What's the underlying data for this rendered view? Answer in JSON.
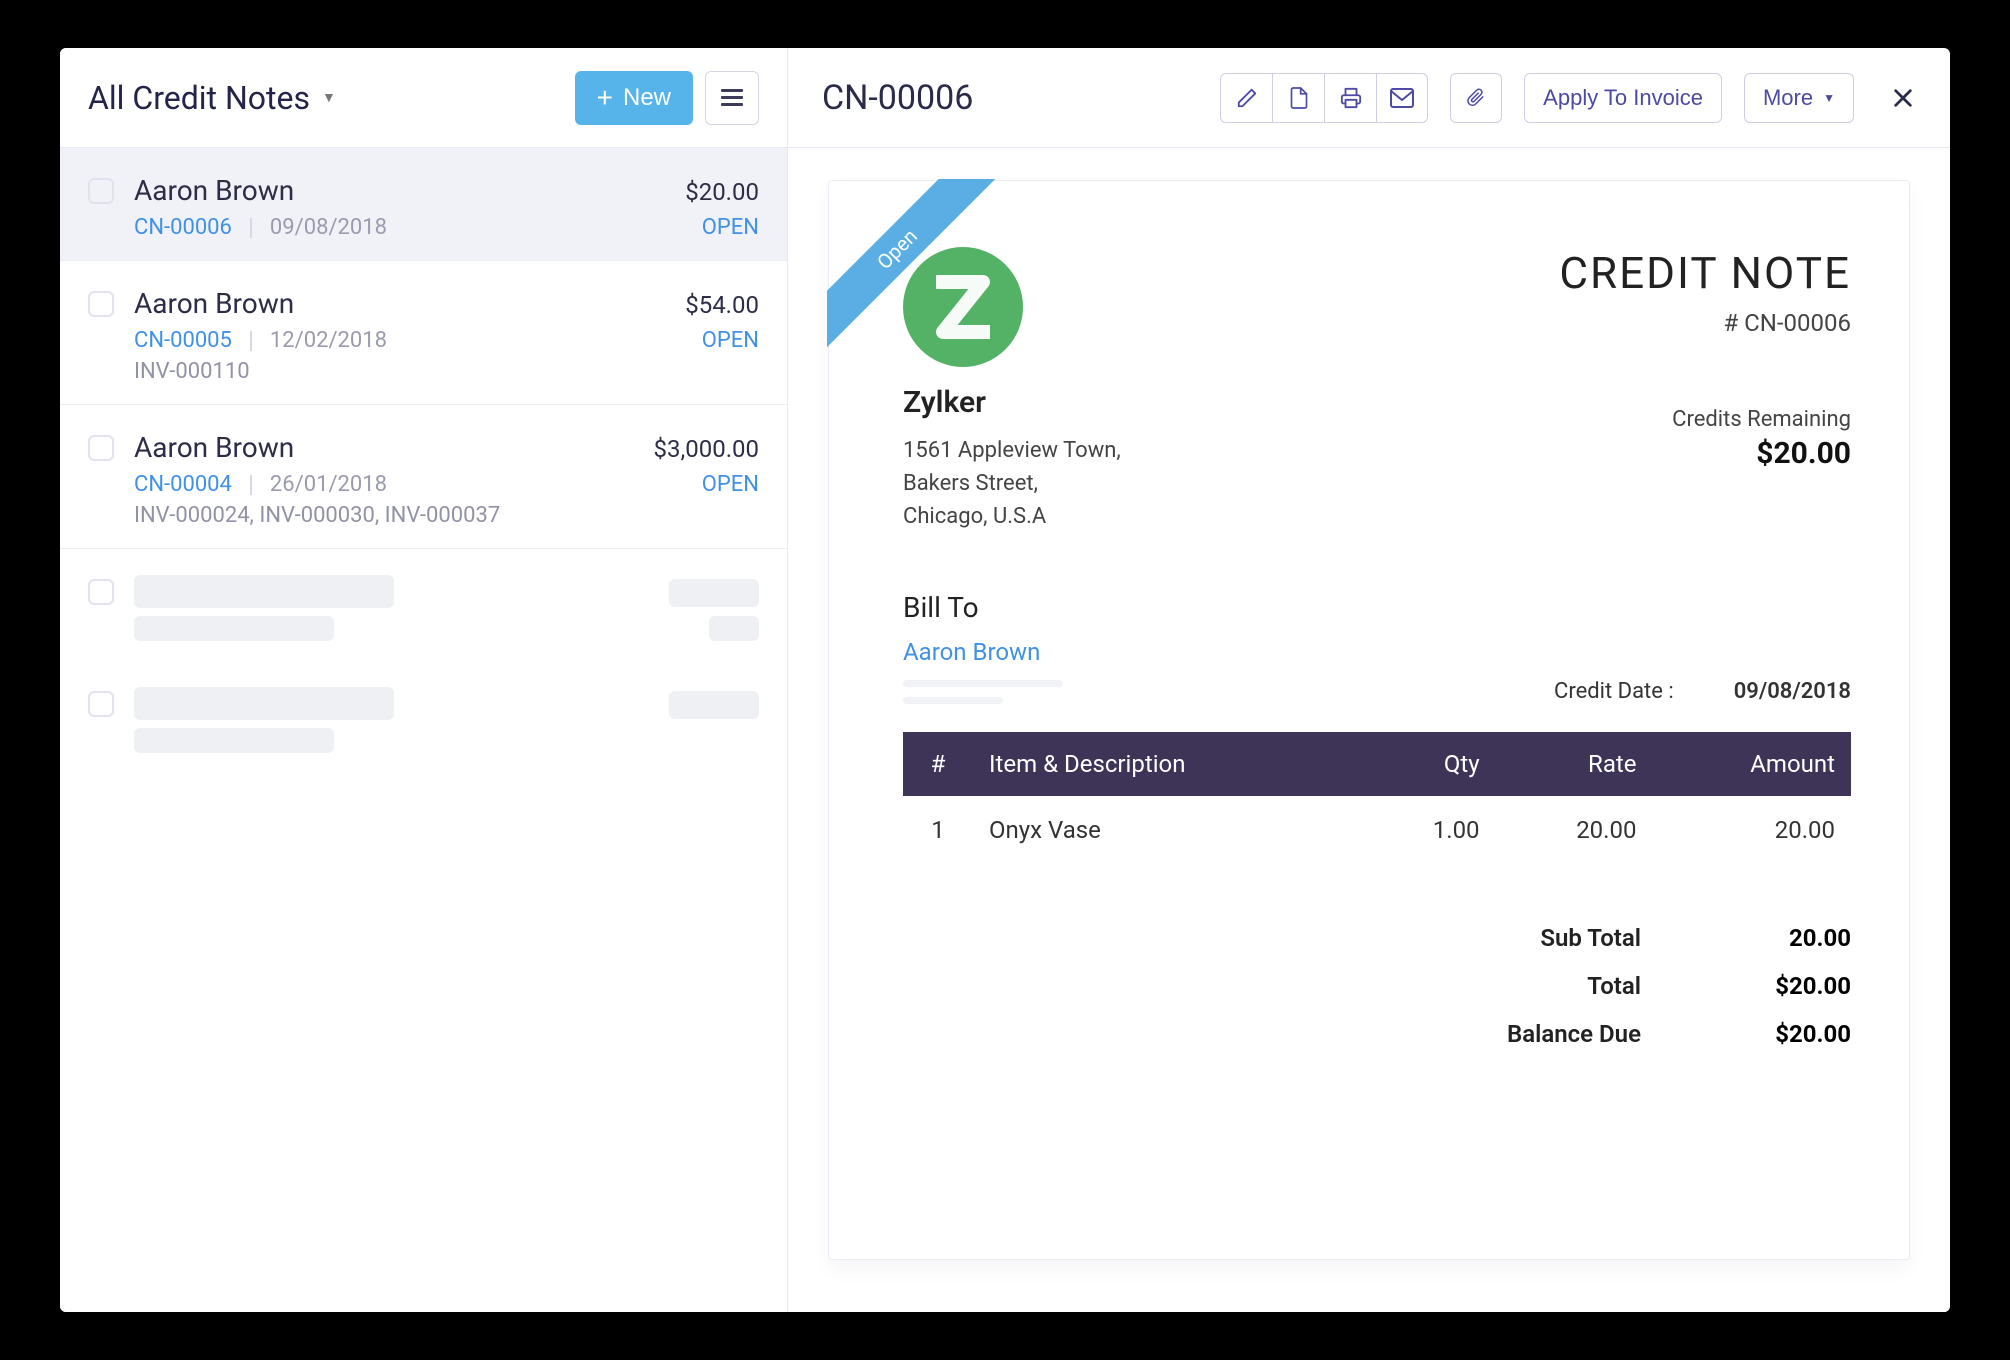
{
  "sidebar": {
    "title": "All Credit Notes",
    "new_label": "New",
    "items": [
      {
        "name": "Aaron Brown",
        "amount": "$20.00",
        "id": "CN-00006",
        "date": "09/08/2018",
        "status": "OPEN",
        "invoices": "",
        "selected": true
      },
      {
        "name": "Aaron Brown",
        "amount": "$54.00",
        "id": "CN-00005",
        "date": "12/02/2018",
        "status": "OPEN",
        "invoices": "INV-000110",
        "selected": false
      },
      {
        "name": "Aaron Brown",
        "amount": "$3,000.00",
        "id": "CN-00004",
        "date": "26/01/2018",
        "status": "OPEN",
        "invoices": "INV-000024, INV-000030, INV-000037",
        "selected": false
      }
    ]
  },
  "detail": {
    "title": "CN-00006",
    "apply_label": "Apply To Invoice",
    "more_label": "More",
    "ribbon": "Open",
    "brand": {
      "name": "Zylker",
      "addr1": "1561 Appleview Town,",
      "addr2": "Bakers Street,",
      "addr3": "Chicago, U.S.A"
    },
    "kind": "CREDIT NOTE",
    "number": "# CN-00006",
    "credits_label": "Credits Remaining",
    "credits_amount": "$20.00",
    "bill_to_label": "Bill To",
    "bill_to_name": "Aaron Brown",
    "date_label": "Credit Date :",
    "date_value": "09/08/2018",
    "columns": {
      "num": "#",
      "item": "Item & Description",
      "qty": "Qty",
      "rate": "Rate",
      "amount": "Amount"
    },
    "row": {
      "num": "1",
      "item": "Onyx Vase",
      "qty": "1.00",
      "rate": "20.00",
      "amount": "20.00"
    },
    "totals": {
      "subtotal_label": "Sub Total",
      "subtotal_value": "20.00",
      "total_label": "Total",
      "total_value": "$20.00",
      "balance_label": "Balance Due",
      "balance_value": "$20.00"
    }
  }
}
